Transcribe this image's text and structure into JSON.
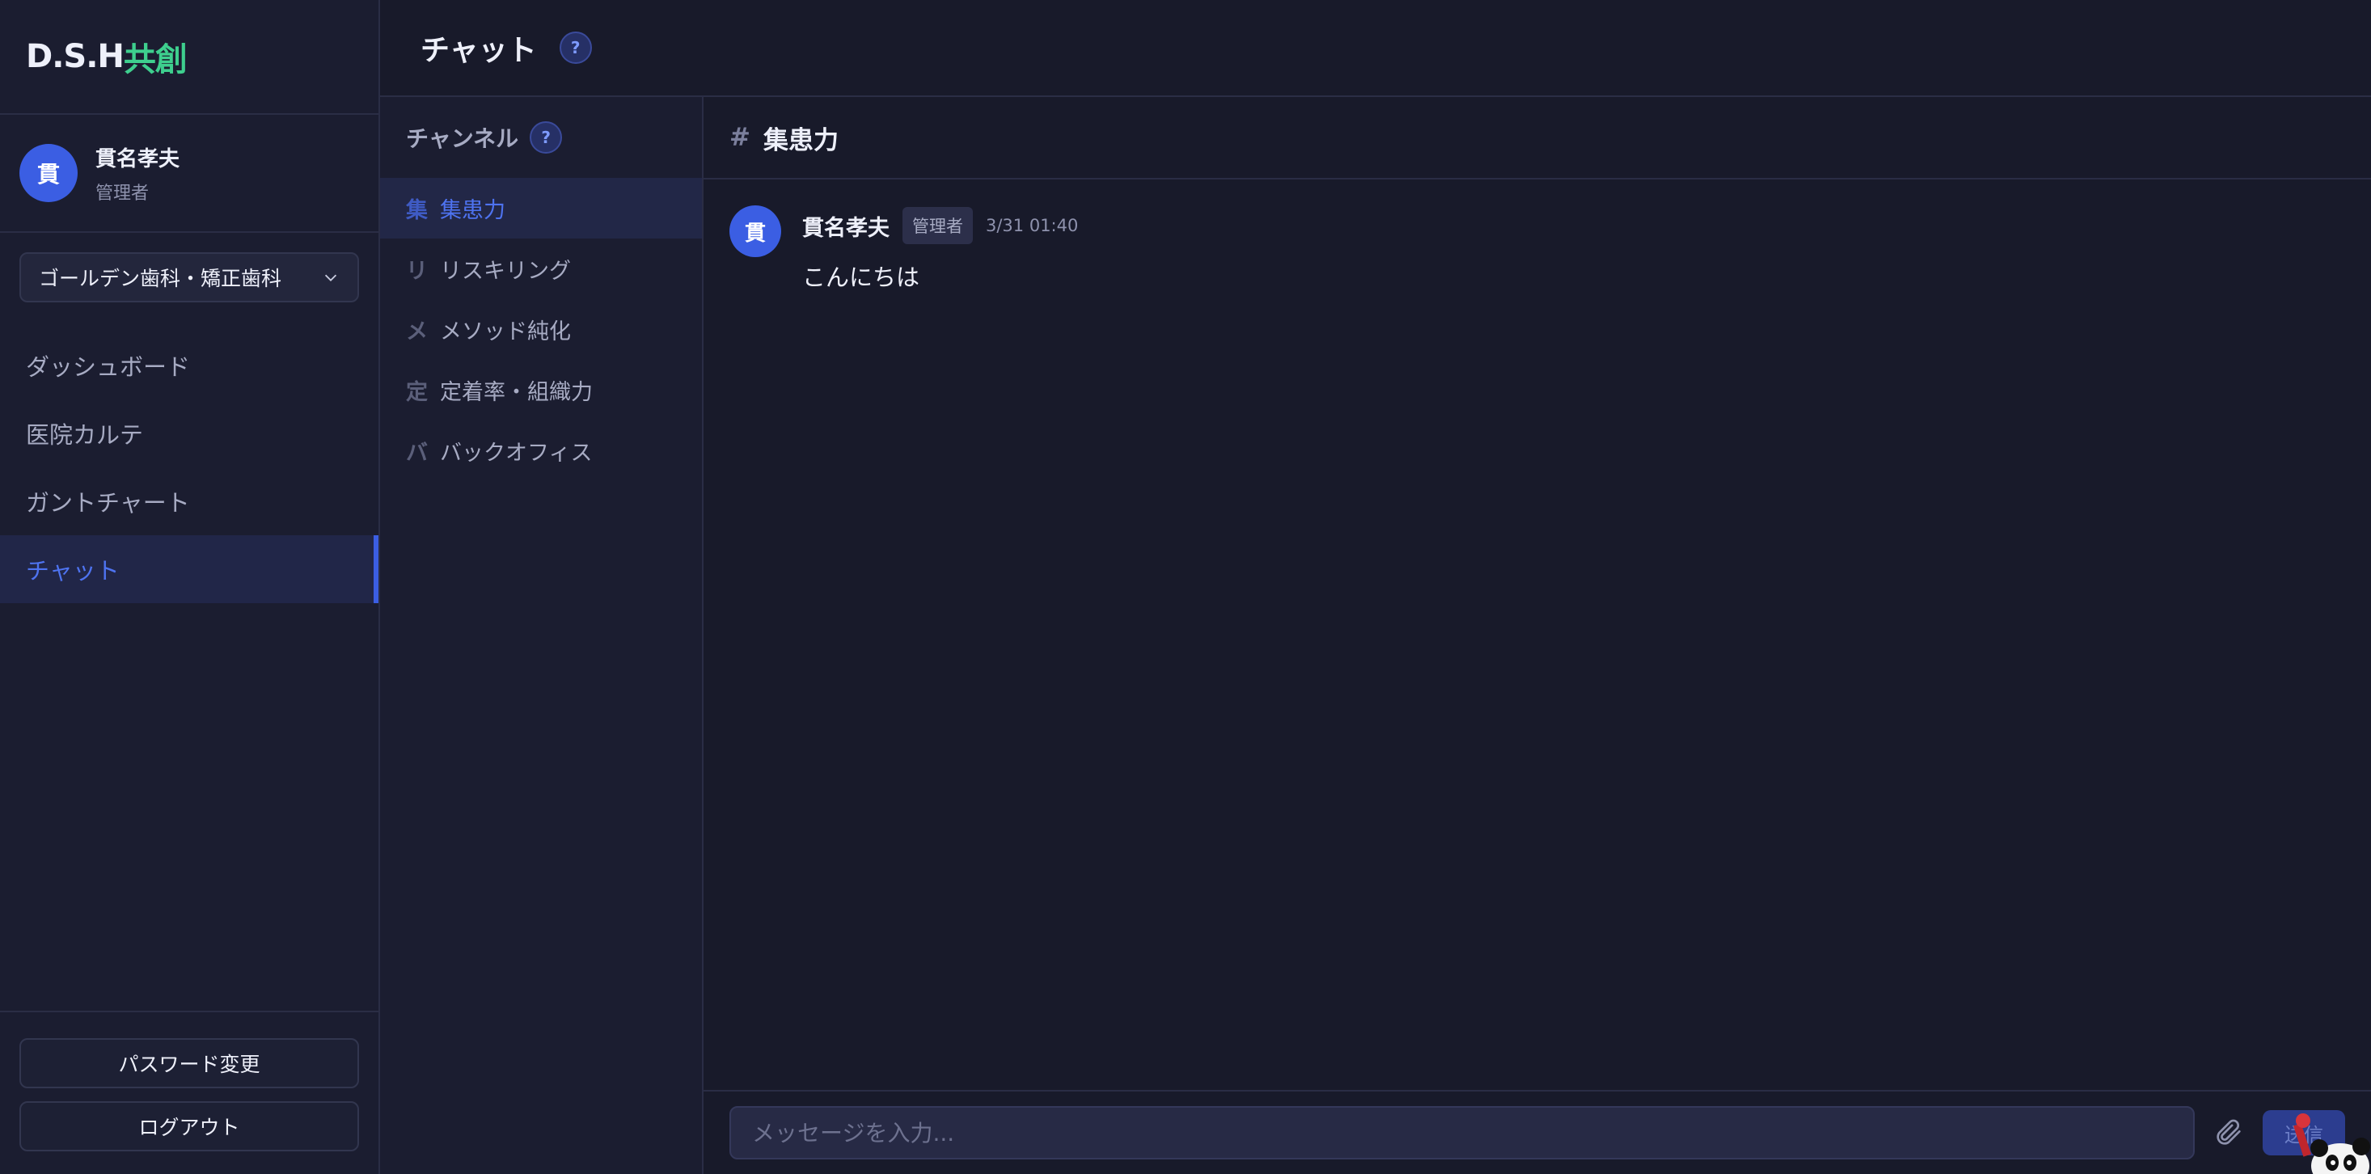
{
  "brand": {
    "part1": "D.S.H",
    "part2": "共創"
  },
  "user": {
    "avatar_initial": "貫",
    "name": "貫名孝夫",
    "role": "管理者"
  },
  "clinic_select": {
    "value": "ゴールデン歯科・矯正歯科"
  },
  "nav": {
    "items": [
      {
        "label": "ダッシュボード",
        "active": false
      },
      {
        "label": "医院カルテ",
        "active": false
      },
      {
        "label": "ガントチャート",
        "active": false
      },
      {
        "label": "チャット",
        "active": true
      }
    ]
  },
  "sidebar_bottom": {
    "password_label": "パスワード変更",
    "logout_label": "ログアウト"
  },
  "header": {
    "title": "チャット",
    "help_icon": "?"
  },
  "channels": {
    "title": "チャンネル",
    "help_icon": "?",
    "items": [
      {
        "initial": "集",
        "label": "集患力",
        "active": true
      },
      {
        "initial": "リ",
        "label": "リスキリング",
        "active": false
      },
      {
        "initial": "メ",
        "label": "メソッド純化",
        "active": false
      },
      {
        "initial": "定",
        "label": "定着率・組織力",
        "active": false
      },
      {
        "initial": "バ",
        "label": "バックオフィス",
        "active": false
      }
    ]
  },
  "chat": {
    "hash": "#",
    "channel_name": "集患力",
    "messages": [
      {
        "avatar_initial": "貫",
        "author": "貫名孝夫",
        "badge": "管理者",
        "time": "3/31 01:40",
        "text": "こんにちは"
      }
    ]
  },
  "composer": {
    "placeholder": "メッセージを入力...",
    "send_label": "送信"
  },
  "colors": {
    "accent": "#3b5ee3",
    "brand_green": "#3ecf8e",
    "background": "#181a2a"
  }
}
